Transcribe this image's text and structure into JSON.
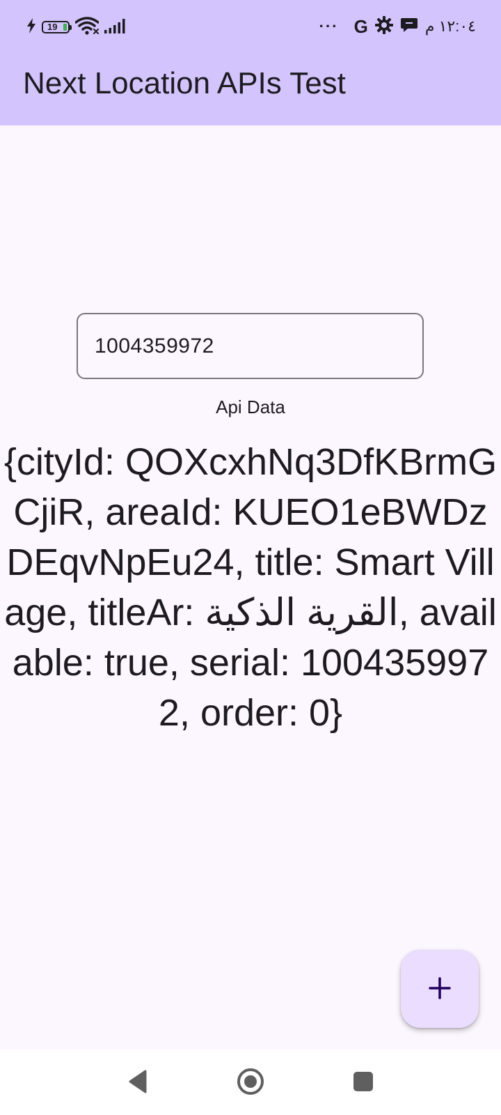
{
  "status_bar": {
    "battery_level": "19",
    "time": "١٢:٠٤ م",
    "overflow_dots": "···",
    "google_icon_letter": "G"
  },
  "app_bar": {
    "title": "Next Location APIs Test"
  },
  "main": {
    "serial_input": {
      "value": "1004359972"
    },
    "api_label": "Api Data",
    "api_result": "{cityId: QOXcxhNq3DfKBrmGCjiR, areaId: KUEO1eBWDzDEqvNpEu24, title: Smart Village, titleAr: القرية الذكية, available: true, serial: 1004359972, order: 0}"
  },
  "fab": {
    "icon": "plus-icon"
  },
  "nav_bar": {
    "icons": [
      "back-icon",
      "home-icon",
      "recents-icon"
    ]
  },
  "colors": {
    "app_bar": "#d3c4fd",
    "background": "#fcf7ff",
    "fab": "#ebddff",
    "outline": "#79747e",
    "text": "#1d1b20",
    "battery_fill": "#3bb34a"
  }
}
